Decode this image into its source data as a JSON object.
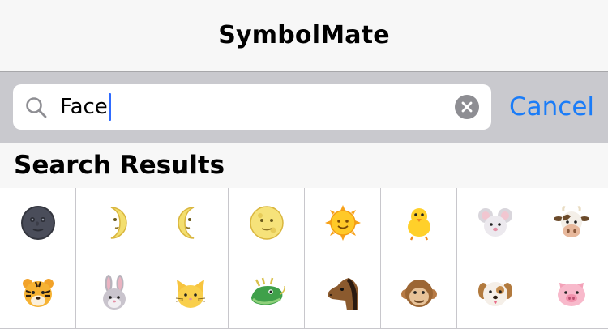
{
  "navbar": {
    "title": "SymbolMate"
  },
  "search": {
    "value": "Face",
    "cancel_label": "Cancel"
  },
  "section": {
    "header": "Search Results"
  },
  "results": [
    [
      "new-moon-face",
      "first-quarter-moon-face",
      "last-quarter-moon-face",
      "full-moon-face",
      "sun-face",
      "baby-chick",
      "mouse-face",
      "cow-face"
    ],
    [
      "tiger-face",
      "rabbit-face",
      "cat-face",
      "dragon-face",
      "horse-face",
      "monkey-face",
      "dog-face",
      "pig-face"
    ]
  ],
  "colors": {
    "accent": "#1a7cf8",
    "caret": "#2f6bff",
    "search_bar_bg": "#c9c9ce"
  }
}
